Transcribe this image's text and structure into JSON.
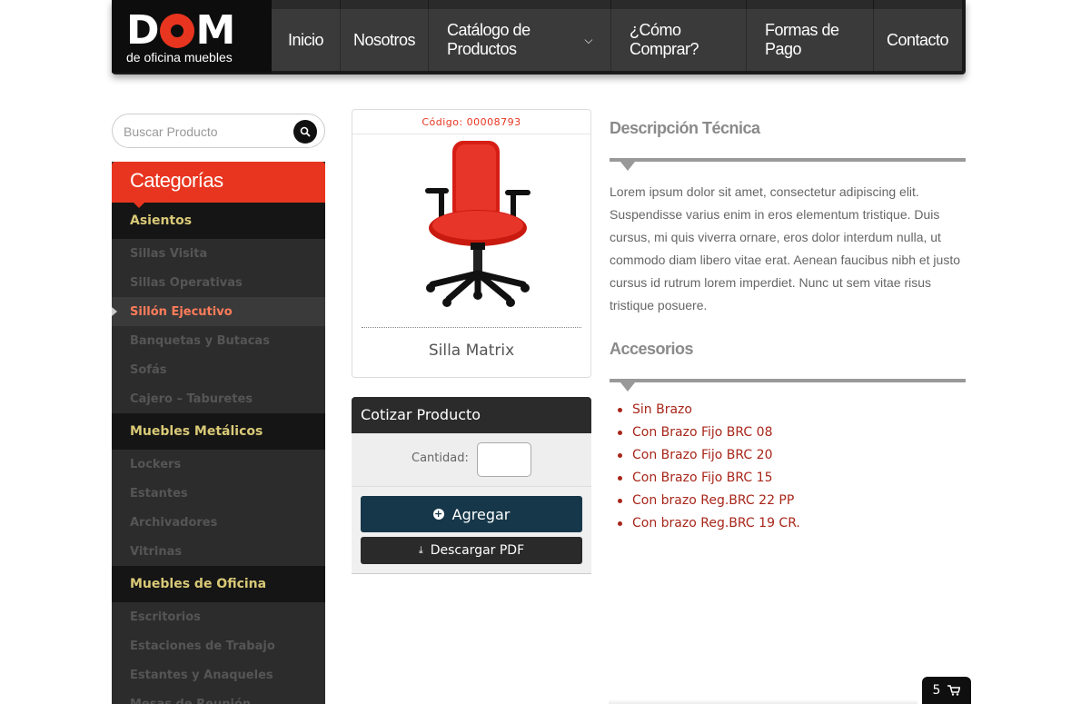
{
  "header": {
    "logo_text": "DOM",
    "logo_sub": "de oficina muebles",
    "nav": [
      {
        "label": "Inicio"
      },
      {
        "label": "Nosotros"
      },
      {
        "label": "Catálogo de Productos"
      },
      {
        "label": "¿Cómo Comprar?"
      },
      {
        "label": "Formas de Pago"
      },
      {
        "label": "Contacto"
      }
    ]
  },
  "search": {
    "placeholder": "Buscar Producto"
  },
  "sidebar": {
    "title": "Categorías",
    "groups": [
      {
        "label": "Asientos",
        "items": [
          "Sillas Visita",
          "Sillas Operativas",
          "Sillón Ejecutivo",
          "Banquetas y Butacas",
          "Sofás",
          "Cajero – Taburetes"
        ]
      },
      {
        "label": "Muebles Metálicos",
        "items": [
          "Lockers",
          "Estantes",
          "Archivadores",
          "Vitrinas"
        ]
      },
      {
        "label": "Muebles de Oficina",
        "items": [
          "Escritorios",
          "Estaciones de Trabajo",
          "Estantes y Anaqueles",
          "Mesas de Reunión"
        ]
      }
    ],
    "active_item": "Sillón Ejecutivo"
  },
  "product": {
    "code": "Código: 00008793",
    "name": "Silla Matrix"
  },
  "quote": {
    "title": "Cotizar Producto",
    "qty_label": "Cantidad:",
    "qty_value": "",
    "add_label": "Agregar",
    "pdf_label": "Descargar PDF"
  },
  "description": {
    "title": "Descripción Técnica",
    "text": "Lorem ipsum dolor sit amet, consectetur adipiscing elit. Suspendisse varius enim in eros elementum tristique. Duis cursus, mi quis viverra ornare, eros dolor interdum nulla, ut commodo diam libero vitae erat. Aenean faucibus nibh et justo cursus id rutrum lorem imperdiet. Nunc ut sem vitae risus tristique posuere."
  },
  "accessories": {
    "title": "Accesorios",
    "items": [
      "Sin Brazo",
      "Con Brazo Fijo BRC 08",
      "Con Brazo Fijo BRC 20",
      "Con Brazo Fijo BRC 15",
      "Con brazo Reg.BRC 22 PP",
      "Con brazo Reg.BRC 19 CR."
    ]
  },
  "cart": {
    "count": "5"
  },
  "colors": {
    "accent": "#e8351f",
    "nav_bg": "#3a3a3a",
    "button_primary": "#163749",
    "accessory_text": "#a8261a",
    "group_text": "#d9c977"
  }
}
